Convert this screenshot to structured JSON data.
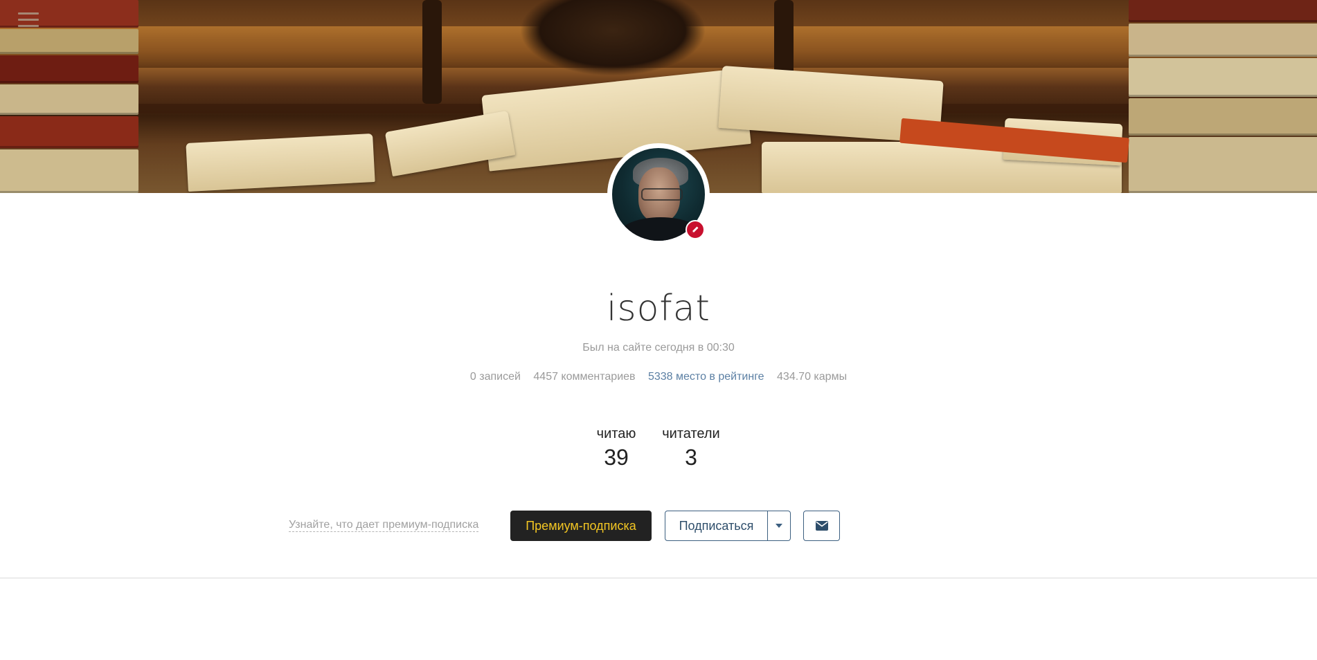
{
  "profile": {
    "username": "isofat",
    "last_seen": "Был на сайте сегодня в 00:30",
    "stats": {
      "posts": "0 записей",
      "comments": "4457 комментариев",
      "rating": "5338 место в рейтинге",
      "karma": "434.70 кармы"
    },
    "reading": {
      "label": "читаю",
      "count": "39"
    },
    "readers": {
      "label": "читатели",
      "count": "3"
    }
  },
  "actions": {
    "premium_info_link": "Узнайте, что дает премиум-подписка",
    "premium_button": "Премиум-подписка",
    "subscribe_button": "Подписаться"
  },
  "icons": {
    "menu": "hamburger-menu-icon",
    "author_badge": "pen-icon",
    "dropdown": "caret-down-icon",
    "message": "envelope-icon"
  },
  "colors": {
    "premium_bg": "#222222",
    "premium_text": "#f3c623",
    "subscribe_border": "#3c5f80",
    "rating_link": "#5b7fa3",
    "badge": "#c8102e"
  }
}
